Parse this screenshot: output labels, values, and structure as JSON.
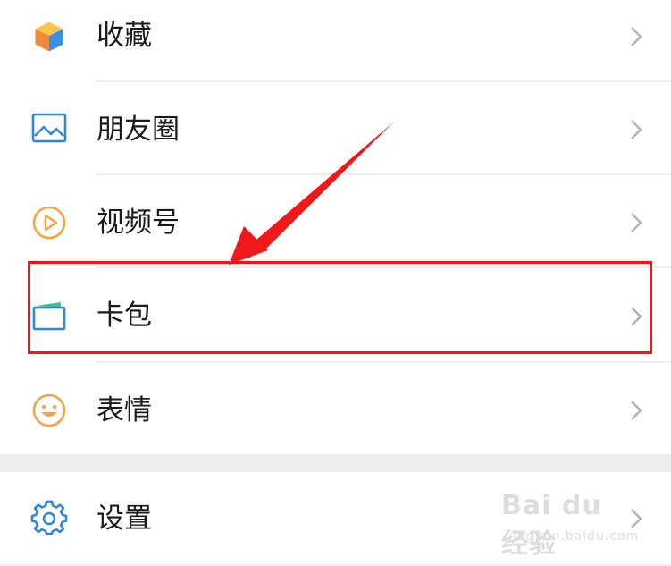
{
  "menu": {
    "items": [
      {
        "label": "收藏",
        "icon": "favorites-cube-icon"
      },
      {
        "label": "朋友圈",
        "icon": "moments-picture-icon"
      },
      {
        "label": "视频号",
        "icon": "channels-play-icon"
      },
      {
        "label": "卡包",
        "icon": "card-wallet-icon"
      },
      {
        "label": "表情",
        "icon": "sticker-smile-icon"
      },
      {
        "label": "设置",
        "icon": "settings-gear-icon"
      }
    ]
  },
  "annotation": {
    "highlight_color": "#ff1010",
    "arrow_color": "#f01818"
  },
  "watermark": {
    "main": "Bai du 经验",
    "sub": "jingyan.baidu.com"
  },
  "colors": {
    "text": "#1a1a1a",
    "divider": "#ededed",
    "chevron": "#b2b2b2"
  }
}
